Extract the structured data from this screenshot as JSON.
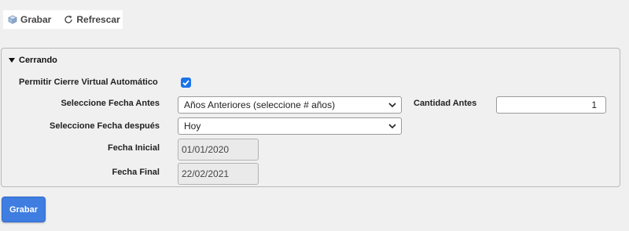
{
  "toolbar": {
    "save_label": "Grabar",
    "save_icon": "cube-icon",
    "refresh_label": "Refrescar",
    "refresh_icon": "refresh-icon"
  },
  "section": {
    "title": "Cerrando"
  },
  "form": {
    "virtual_close_label": "Permitir Cierre Virtual Automático",
    "virtual_close_checked": true,
    "date_before_label": "Seleccione Fecha Antes",
    "date_before_value": "Años Anteriores (seleccione # años)",
    "quantity_before_label": "Cantidad Antes",
    "quantity_before_value": "1",
    "date_after_label": "Seleccione Fecha después",
    "date_after_value": "Hoy",
    "start_date_label": "Fecha Inicial",
    "start_date_value": "01/01/2020",
    "end_date_label": "Fecha Final",
    "end_date_value": "22/02/2021"
  },
  "footer": {
    "save_button_label": "Grabar"
  },
  "colors": {
    "accent": "#3f7ee0",
    "checkbox": "#1a73e8"
  }
}
